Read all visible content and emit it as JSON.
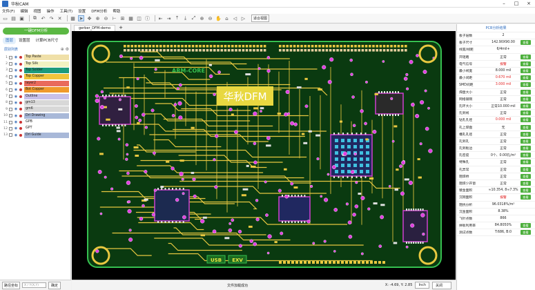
{
  "window": {
    "title": "华秋CAM"
  },
  "menu": [
    "文件(F)",
    "编辑",
    "视图",
    "操作",
    "工具(T)",
    "设置",
    "DFM分析",
    "帮助"
  ],
  "toolbar": {
    "view_label": "适合视图"
  },
  "left": {
    "dfm_button": "一键DFM分析",
    "tabs": [
      "图层",
      "设置层",
      "计算PCB尺寸"
    ],
    "layer_header": "层别列表",
    "layers": [
      {
        "num": "1",
        "name": "Top Paste",
        "color": "#f0e0a8"
      },
      {
        "num": "2",
        "name": "Top Silk",
        "color": "#f2f2c2"
      },
      {
        "num": "3",
        "name": "Top Solder",
        "color": "#1c9a7c"
      },
      {
        "num": "4",
        "name": "Top Copper",
        "color": "#f0c43c"
      },
      {
        "num": "5",
        "name": "layer2",
        "color": "#e96a5c"
      },
      {
        "num": "6",
        "name": "Bot Copper",
        "color": "#ef9a2c"
      },
      {
        "num": "7",
        "name": "Outline",
        "color": "#c8c0e8"
      },
      {
        "num": "8",
        "name": "gm13",
        "color": "#d8d8d8"
      },
      {
        "num": "9",
        "name": "gm6",
        "color": "#d8d8d8"
      },
      {
        "num": "10",
        "name": "Drl Drawing",
        "color": "#a8b8d8"
      },
      {
        "num": "11",
        "name": "GPB",
        "color": "#ffffff"
      },
      {
        "num": "12",
        "name": "GPT",
        "color": "#ffffff"
      },
      {
        "num": "13",
        "name": "Drl Guide",
        "color": "#a8b8d8"
      }
    ],
    "bottom": {
      "measure_button": "路径坐标",
      "coord_placeholder": "X / Y(X,Y)",
      "confirm": "确定"
    }
  },
  "document": {
    "tab": "gerber_DFM-demo",
    "add": "+"
  },
  "board": {
    "watermark": "华秋DFM",
    "silk_label": "ARM-CORE",
    "usb_label": "USB",
    "ext_label": "EXV"
  },
  "status": {
    "message": "文件加载成功",
    "coord": "X: -4.69, Y: 2.85",
    "unit": "Inch",
    "mode": "关闭"
  },
  "right": {
    "title": "PCB分析结果",
    "rows": [
      {
        "k": "板子层数",
        "v": "2",
        "warn": false,
        "btn": ""
      },
      {
        "k": "板子尺寸",
        "v": "142.90X90.00",
        "warn": false,
        "btn": "查看"
      },
      {
        "k": "线宽/线距",
        "v": "6/4mil+",
        "warn": false,
        "btn": ""
      },
      {
        "k": "开短路",
        "v": "正常",
        "warn": false,
        "btn": "查看"
      },
      {
        "k": "电气信号",
        "v": "报警",
        "warn": true,
        "btn": "查看"
      },
      {
        "k": "最小线宽",
        "v": "8.000 mil",
        "warn": false,
        "btn": "查看"
      },
      {
        "k": "最小间距",
        "v": "0.670 mil",
        "warn": true,
        "btn": "查看"
      },
      {
        "k": "SMD间距",
        "v": "3.000 mil",
        "warn": true,
        "btn": "查看"
      },
      {
        "k": "焊盘大小",
        "v": "正常",
        "warn": false,
        "btn": "查看"
      },
      {
        "k": "网络铺铜",
        "v": "正常",
        "warn": false,
        "btn": "查看"
      },
      {
        "k": "孔环大小",
        "v": "正常10.000 mil",
        "warn": false,
        "btn": "查看"
      },
      {
        "k": "孔到线",
        "v": "正常",
        "warn": false,
        "btn": "查看"
      },
      {
        "k": "钻孔孔径",
        "v": "0.000 mil",
        "warn": true,
        "btn": "查看"
      },
      {
        "k": "孔上焊盘",
        "v": "无",
        "warn": false,
        "btn": "查看"
      },
      {
        "k": "槽孔孔径",
        "v": "正常",
        "warn": false,
        "btn": "查看"
      },
      {
        "k": "孔到孔",
        "v": "正常",
        "warn": false,
        "btn": "查看"
      },
      {
        "k": "孔到板边",
        "v": "正常",
        "warn": false,
        "btn": "查看"
      },
      {
        "k": "孔密度",
        "v": "0个、0.00孔/m²",
        "warn": false,
        "btn": "查看"
      },
      {
        "k": "特殊孔",
        "v": "正常",
        "warn": false,
        "btn": "查看"
      },
      {
        "k": "孔异常",
        "v": "正常",
        "warn": false,
        "btn": "查看"
      },
      {
        "k": "阻焊桥",
        "v": "正常",
        "warn": false,
        "btn": "查看"
      },
      {
        "k": "阻焊少开窗",
        "v": "正常",
        "warn": false,
        "btn": "查看"
      },
      {
        "k": "镀金面积",
        "v": "≈10.354, 8≈7.3%",
        "warn": false,
        "btn": "查看"
      },
      {
        "k": "沉铜面积",
        "v": "报警",
        "warn": true,
        "btn": "查看"
      },
      {
        "k": "阻抗分析",
        "v": "96.0318%/m²",
        "warn": false,
        "btn": ""
      },
      {
        "k": "沉金面积",
        "v": "8.38%",
        "warn": false,
        "btn": ""
      },
      {
        "k": "飞针点数",
        "v": "866",
        "warn": false,
        "btn": ""
      },
      {
        "k": "拼板利用率",
        "v": "84.8050%",
        "warn": false,
        "btn": "查看"
      },
      {
        "k": "测试点数",
        "v": "T:686, B:0",
        "warn": false,
        "btn": "查看"
      }
    ]
  },
  "colors": {
    "accent": "#2d6cc0",
    "ok_button": "#4caf3c",
    "dfm_button": "#5bb843",
    "warn": "#e02020",
    "board_green": "#1c9a3c",
    "trace_yellow": "#e8c840"
  }
}
